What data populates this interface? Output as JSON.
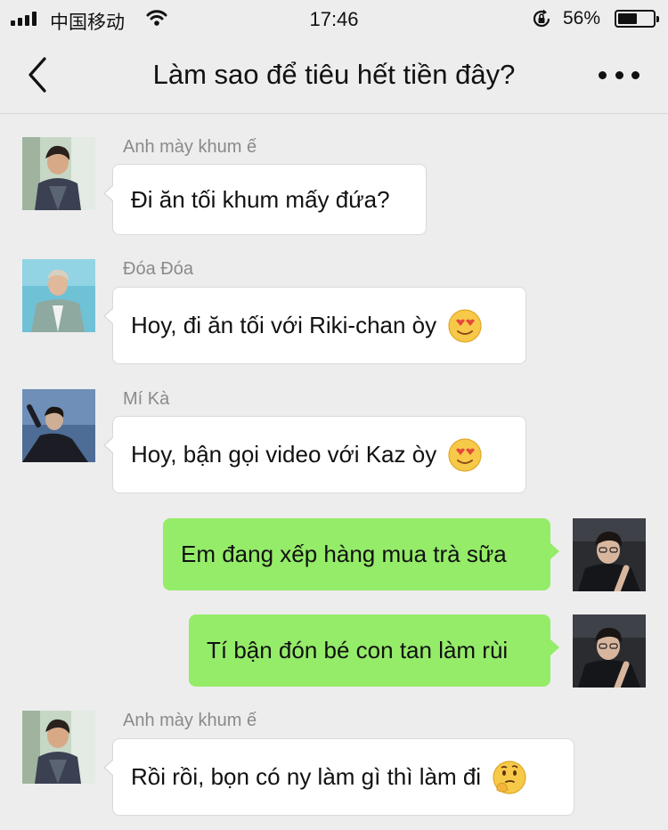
{
  "status_bar": {
    "carrier": "中国移动",
    "time": "17:46",
    "battery_percent": "56%",
    "battery_level": 0.56,
    "icons": [
      "signal-icon",
      "wifi-icon",
      "rotation-lock-icon",
      "battery-icon"
    ]
  },
  "nav": {
    "title": "Làm sao để tiêu hết tiền đây?",
    "back_icon": "chevron-left-icon",
    "more_icon": "more-dots-icon"
  },
  "colors": {
    "background": "#ededed",
    "incoming_bubble": "#ffffff",
    "outgoing_bubble": "#95ec69",
    "sender_name": "#8a8a8a"
  },
  "messages": [
    {
      "sender": "Anh mày khum ế",
      "text": "Đi ăn tối khum mấy đứa?",
      "direction": "in"
    },
    {
      "sender": "Đóa Đóa",
      "text": "Hoy, đi ăn tối với Riki-chan òy",
      "direction": "in",
      "emoji": "heart-eyes-emoji"
    },
    {
      "sender": "Mí Kà",
      "text": "Hoy, bận gọi video với Kaz òy",
      "direction": "in",
      "emoji": "heart-eyes-emoji"
    },
    {
      "text": "Em đang xếp hàng mua trà sữa",
      "direction": "out"
    },
    {
      "text": "Tí bận đón bé con tan làm rùi",
      "direction": "out"
    },
    {
      "sender": "Anh mày khum ế",
      "text": "Rồi rồi, bọn có ny làm gì thì làm đi",
      "direction": "in",
      "emoji": "thinking-emoji"
    }
  ]
}
